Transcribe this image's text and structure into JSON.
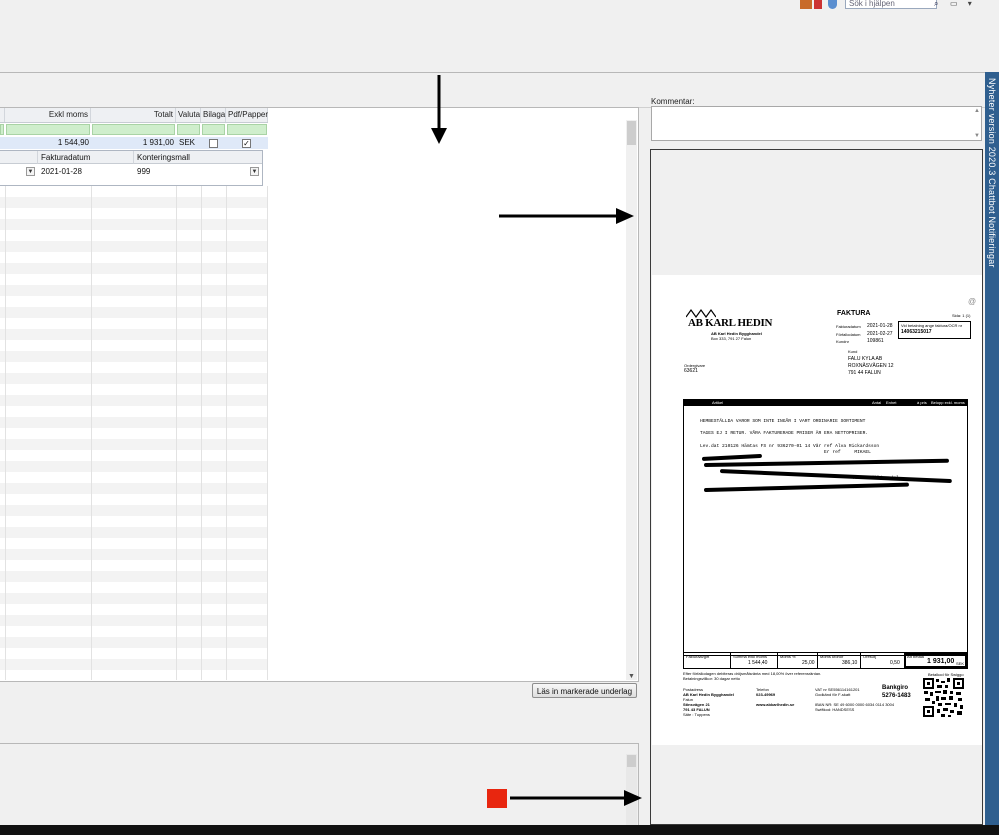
{
  "toolbar": {
    "search_placeholder": "Sök i hjälpen",
    "icons": [
      "app-icon",
      "shield-icon",
      "flag-icon",
      "globe-icon"
    ],
    "window_buttons": "▭ ▾"
  },
  "grid": {
    "columns": {
      "exkl_moms": "Exkl moms",
      "totalt": "Totalt",
      "valuta": "Valuta",
      "bilaga": "Bilaga",
      "pdf_papper": "Pdf/Papper"
    },
    "row": {
      "exkl_moms": "1 544,90",
      "totalt": "1 931,00",
      "valuta": "SEK",
      "bilaga_checked": false,
      "pdf_checked": true
    },
    "detail": {
      "fakturadatum_label": "Fakturadatum",
      "fakturadatum_value": "2021-01-28",
      "konteringsmall_label": "Konteringsmall",
      "konteringsmall_value": "999"
    }
  },
  "buttons": {
    "las_in": "Läs in markerade underlag"
  },
  "comment": {
    "label": "Kommentar:"
  },
  "side_panel": {
    "text": "Nyheter version 2020.3  Chattbot  Notifieringar"
  },
  "invoice": {
    "company_logo": "AB KARL HEDIN",
    "company_sub1": "AB Karl Hedin Bygghandel",
    "company_sub2": "Box 333, 791 27 Falun",
    "title": "FAKTURA",
    "page": "Sida: 1 (1)",
    "fakturadatum_label": "Fakturadatum",
    "fakturadatum": "2021-01-28",
    "forfallodatum_label": "Förfallodatum",
    "forfallodatum": "2021-02-27",
    "kundnr_label": "Kundnr",
    "kundnr": "109861",
    "ocr_label": "Vid betalning ange faktura/OCR nr",
    "ocr": "14063215017",
    "kund_label": "Kund",
    "kund_name": "FALU KYLA AB",
    "kund_street": "ROXNÄSVÄGEN 12",
    "kund_city": "791 44 FALUN",
    "ordergivare_label": "Ordergivare",
    "ordergivare": "63621",
    "table_headers": [
      "Artikel",
      "Antal",
      "Enhet",
      "à pris",
      "Belopp exkl. moms"
    ],
    "lines": [
      "HEMBESTÄLLDA VAROR SOM INTE INGÅR I VART ORDINARIE SORTIMENT",
      "TAGES EJ I RETUR. VÅRA FAKTURERADE PRISER ÄR ERA NETTOPRISER.",
      "Lev.dat 210126  Hämtas    FS nr  936270-01  14  Vår ref Alva Rickardsson",
      "                                             Er ref     MIKAEL",
      "Totalt följesedel"
    ],
    "summary_labels": [
      "Fakturaavgift",
      "Summa exkl moms",
      "Moms %",
      "Moms kronor",
      "Öresutj",
      "Att betala"
    ],
    "summary_values": [
      "",
      "1 544,40",
      "25,00",
      "386,10",
      "0,50",
      "1 931,00"
    ],
    "summary_currency": "SEK",
    "footer_note1": "Efter förfallodagen debiteras dröjsmålsränta med 18,00% över referensräntan.",
    "footer_note2": "Betalningsvillkor: 30 dagar netto",
    "postadress_label": "Postadress",
    "postadress": [
      "AB Karl Hedin Bygghandel",
      "Falun",
      "Stinsvägen 21",
      "791 43 FALUN",
      "Säte : Tuppens"
    ],
    "telefon_label": "Telefon",
    "telefon": "023-49969",
    "website": "www.abkarlhedin.se",
    "vat": "VAT nr SE556114161201",
    "fskatt": "Godkänd för F-skatt",
    "iban": "IBAN NR: SE 49 6000 0000 6034 0114 3004",
    "swift": "Swiftkod: HANDSESS",
    "bankgiro_label": "Bankgiro",
    "bankgiro": "5276-1483",
    "qr_label": "Betalkod för Swiggo"
  },
  "colors": {
    "side_strip": "#2f5f8f",
    "filter_green": "#cfeecc",
    "selected_row": "#dfe9f8",
    "red_marker": "#e8260f"
  }
}
